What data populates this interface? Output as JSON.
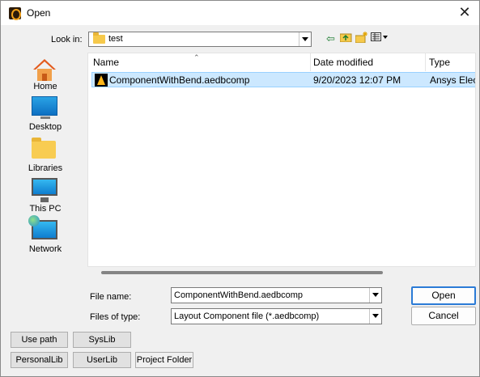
{
  "window": {
    "title": "Open",
    "close_glyph": "✕"
  },
  "lookin": {
    "label": "Look in:",
    "value": "test",
    "toolbar_icons": [
      "back-arrow-icon",
      "up-folder-icon",
      "new-folder-icon",
      "view-menu-icon"
    ]
  },
  "places": [
    {
      "label": "Home",
      "icon": "home-icon"
    },
    {
      "label": "Desktop",
      "icon": "desktop-icon"
    },
    {
      "label": "Libraries",
      "icon": "libraries-icon"
    },
    {
      "label": "This PC",
      "icon": "this-pc-icon"
    },
    {
      "label": "Network",
      "icon": "network-icon"
    }
  ],
  "filelist": {
    "columns": [
      "Name",
      "Date modified",
      "Type"
    ],
    "rows": [
      {
        "name": "ComponentWithBend.aedbcomp",
        "date": "9/20/2023 12:07 PM",
        "type": "Ansys Elect",
        "icon": "ansys-file-icon",
        "selected": true
      }
    ]
  },
  "filename": {
    "label": "File name:",
    "value": "ComponentWithBend.aedbcomp"
  },
  "filetype": {
    "label": "Files of type:",
    "value": "Layout Component file (*.aedbcomp)"
  },
  "buttons": {
    "open": "Open",
    "cancel": "Cancel"
  },
  "bottom_buttons": {
    "use_path": "Use path",
    "syslib": "SysLib",
    "personallib": "PersonalLib",
    "userlib": "UserLib",
    "project_folder": "Project Folder"
  },
  "colors": {
    "selection_bg": "#cce8ff",
    "accent_border": "#2b7bd6"
  }
}
